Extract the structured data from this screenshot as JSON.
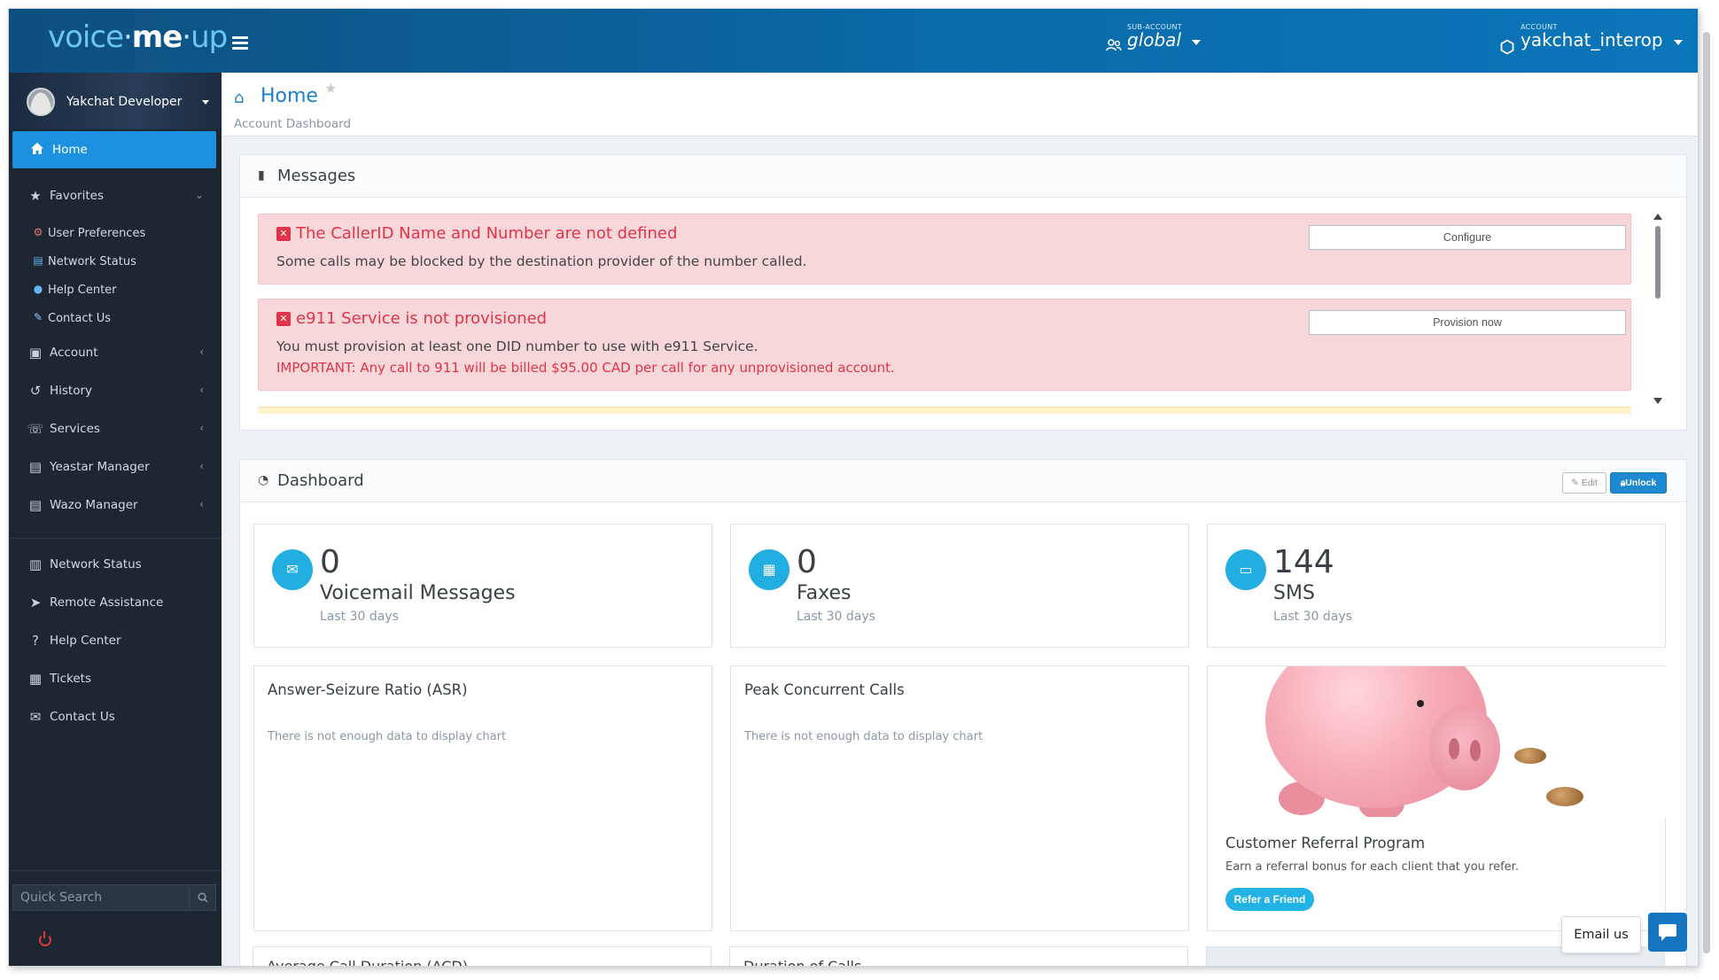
{
  "app": {
    "logo_prefix": "voice",
    "logo_me": "me",
    "logo_suffix": "up",
    "subaccount_label": "SUB-ACCOUNT",
    "subaccount_value": "global",
    "account_label": "ACCOUNT",
    "account_value": "yakchat_interop"
  },
  "sidebar": {
    "user_name": "Yakchat Developer",
    "home_label": "Home",
    "items": [
      {
        "label": "Favorites"
      },
      {
        "label": "User Preferences"
      },
      {
        "label": "Network Status"
      },
      {
        "label": "Help Center"
      },
      {
        "label": "Contact Us"
      },
      {
        "label": "Account"
      },
      {
        "label": "History"
      },
      {
        "label": "Services"
      },
      {
        "label": "Yeastar Manager"
      },
      {
        "label": "Wazo Manager"
      },
      {
        "label": "Network Status"
      },
      {
        "label": "Remote Assistance"
      },
      {
        "label": "Help Center"
      },
      {
        "label": "Tickets"
      },
      {
        "label": "Contact Us"
      }
    ],
    "search_placeholder": "Quick Search"
  },
  "page": {
    "title": "Home",
    "subtitle": "Account Dashboard"
  },
  "messages": {
    "title": "Messages",
    "alert1": {
      "heading": "The CallerID Name and Number are not defined",
      "body": "Some calls may be blocked by the destination provider of the number called.",
      "button": "Configure"
    },
    "alert2": {
      "heading": "e911 Service is not provisioned",
      "body": "You must provision at least one DID number to use with e911 Service.",
      "important": "IMPORTANT: Any call to 911 will be billed $95.00 CAD per call for any unprovisioned account.",
      "button": "Provision now"
    }
  },
  "dashboard": {
    "title": "Dashboard",
    "edit_label": "Edit",
    "unlock_label": "Unlock",
    "stats": [
      {
        "value": "0",
        "label": "Voicemail Messages",
        "sub": "Last 30 days",
        "icon": "envelope-icon"
      },
      {
        "value": "0",
        "label": "Faxes",
        "sub": "Last 30 days",
        "icon": "fax-icon"
      },
      {
        "value": "144",
        "label": "SMS",
        "sub": "Last 30 days",
        "icon": "sms-icon"
      }
    ],
    "asr": {
      "title": "Answer-Seizure Ratio (ASR)",
      "nodata": "There is not enough data to display chart"
    },
    "peak": {
      "title": "Peak Concurrent Calls",
      "nodata": "There is not enough data to display chart"
    },
    "promo": {
      "title": "Customer Referral Program",
      "text": "Earn a referral bonus for each client that you refer.",
      "button": "Refer a Friend"
    },
    "acd_title": "Average Call Duration (ACD)",
    "duration_title": "Duration of Calls"
  },
  "widget": {
    "email_label": "Email us"
  },
  "colors": {
    "brand_blue": "#0b6aa8",
    "accent": "#1e90e0",
    "alert_red": "#e0344b",
    "stat_circle": "#22aee0"
  }
}
